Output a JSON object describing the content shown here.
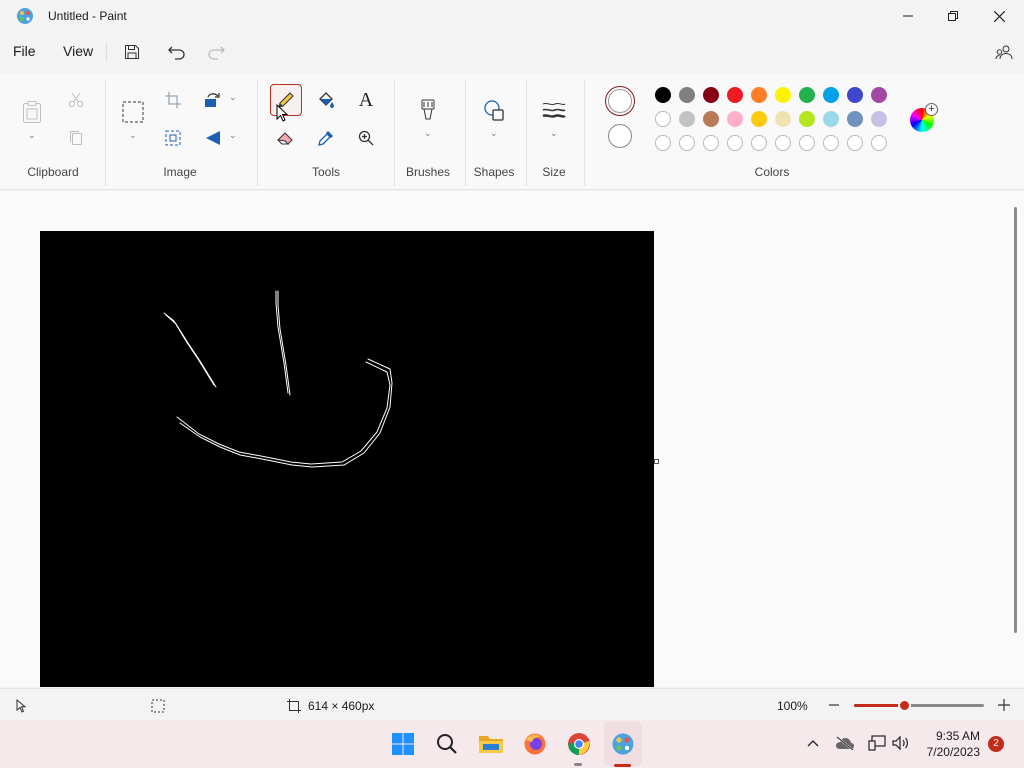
{
  "window": {
    "title": "Untitled - Paint"
  },
  "menu": {
    "file": "File",
    "view": "View"
  },
  "ribbon": {
    "groups": {
      "clipboard": "Clipboard",
      "image": "Image",
      "tools": "Tools",
      "brushes": "Brushes",
      "shapes": "Shapes",
      "size": "Size",
      "colors": "Colors"
    },
    "text_tool_glyph": "A",
    "colors_row1": [
      "#000000",
      "#7f7f7f",
      "#880015",
      "#ed1c24",
      "#ff7f27",
      "#fff200",
      "#22b14c",
      "#00a2e8",
      "#3f48cc",
      "#a349a4"
    ],
    "colors_row2": [
      "#ffffff",
      "#c3c3c3",
      "#b97a57",
      "#ffaec9",
      "#ffc90e",
      "#efe4b0",
      "#b5e61d",
      "#99d9ea",
      "#7092be",
      "#c8bfe7"
    ],
    "primary_color": "#ffffff",
    "accent_color": "#c42b1c"
  },
  "status": {
    "canvas_size": "614 × 460px",
    "zoom": "100%"
  },
  "taskbar": {
    "time": "9:35 AM",
    "date": "7/20/2023",
    "notification_count": "2"
  }
}
